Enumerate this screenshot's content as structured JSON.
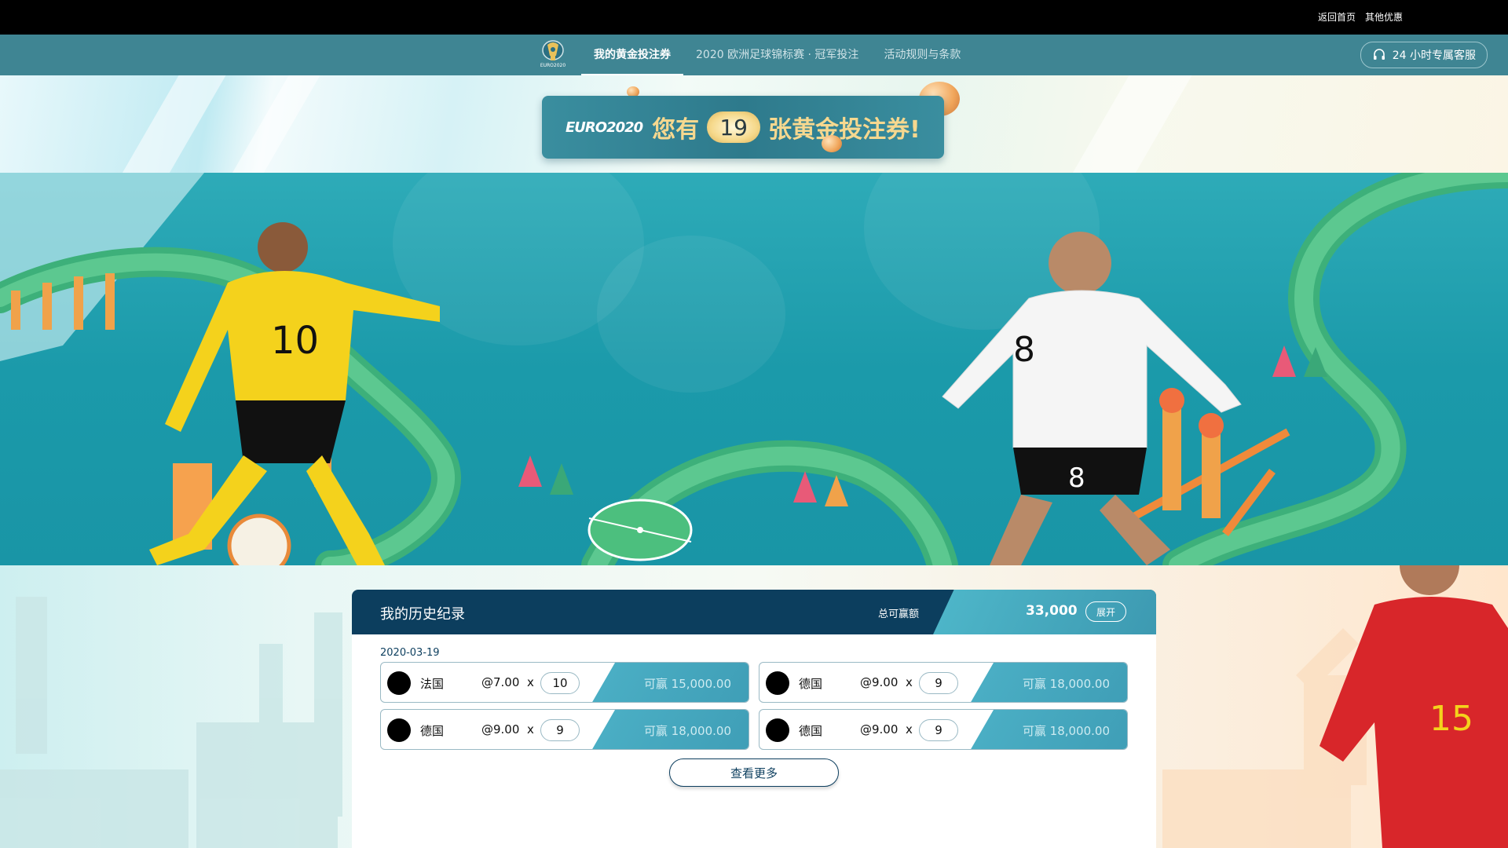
{
  "topbar": {
    "home_link": "返回首页",
    "offers_link": "其他优惠"
  },
  "nav": {
    "logo_text": "EURO2020",
    "tabs": [
      {
        "label": "我的黄金投注券",
        "active": true
      },
      {
        "label": "2020 欧洲足球锦标赛 · 冠军投注",
        "active": false
      },
      {
        "label": "活动规则与条款",
        "active": false
      }
    ],
    "support_label": "24 小时专属客服",
    "support_icon": "headset-icon"
  },
  "coupon": {
    "brand": "EURO2020",
    "prefix": "您有",
    "count": "19",
    "suffix": "张黄金投注券!"
  },
  "history": {
    "title": "我的历史纪录",
    "total_label": "总可赢额",
    "total_value": "33,000",
    "expand_label": "展开",
    "date": "2020-03-19",
    "bets": [
      {
        "team": "法国",
        "odds": "@7.00",
        "multiplier": "x",
        "qty": "10",
        "win": "可赢 15,000.00"
      },
      {
        "team": "德国",
        "odds": "@9.00",
        "multiplier": "x",
        "qty": "9",
        "win": "可赢 18,000.00"
      },
      {
        "team": "德国",
        "odds": "@9.00",
        "multiplier": "x",
        "qty": "9",
        "win": "可赢 18,000.00"
      },
      {
        "team": "德国",
        "odds": "@9.00",
        "multiplier": "x",
        "qty": "9",
        "win": "可赢 18,000.00"
      }
    ],
    "more_label": "查看更多"
  },
  "colors": {
    "nav": "#3f8593",
    "panel_header": "#0c3e5e",
    "accent": "#4aaec4",
    "hero": "#1b9aaa",
    "gold": "#f6d88f"
  }
}
